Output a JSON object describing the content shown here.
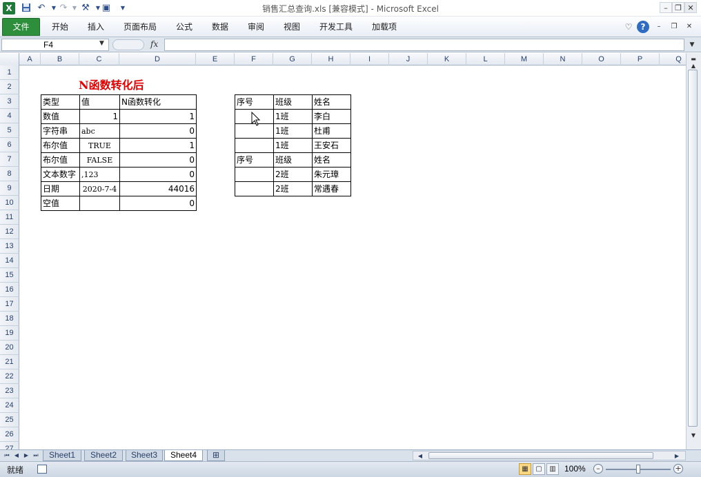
{
  "window": {
    "title": "销售汇总查询.xls  [兼容模式] - Microsoft Excel",
    "app_icon": "excel-logo",
    "brand_color": "#1f7a3a"
  },
  "quick_access": {
    "icons": [
      "save-icon",
      "undo-icon",
      "redo-icon",
      "tools-icon",
      "camera-icon",
      "customize-icon"
    ]
  },
  "ribbon": {
    "tabs": [
      "文件",
      "开始",
      "插入",
      "页面布局",
      "公式",
      "数据",
      "审阅",
      "视图",
      "开发工具",
      "加载项"
    ],
    "active_tab": "文件",
    "active_tab_color": "#2d8f3c"
  },
  "formula_bar": {
    "name_box": "F4",
    "fx_label": "fx",
    "formula": ""
  },
  "grid": {
    "columns": [
      "A",
      "B",
      "C",
      "D",
      "E",
      "F",
      "G",
      "H",
      "I",
      "J",
      "K",
      "L",
      "M",
      "N",
      "O",
      "P",
      "Q"
    ],
    "rows": [
      "1",
      "2",
      "3",
      "4",
      "5",
      "6",
      "7",
      "8",
      "9",
      "10",
      "11",
      "12",
      "13",
      "14",
      "15",
      "16",
      "17",
      "18",
      "19",
      "20",
      "21",
      "22",
      "23",
      "24",
      "25",
      "26",
      "27"
    ],
    "selected_cell": "F4"
  },
  "sheet": {
    "title": "N函数转化后",
    "title_color": "#e00000",
    "table1": {
      "headers": [
        "类型",
        "值",
        "N函数转化"
      ],
      "rows": [
        [
          "数值",
          "1",
          "1"
        ],
        [
          "字符串",
          "abc",
          "0"
        ],
        [
          "布尔值",
          "TRUE",
          "1"
        ],
        [
          "布尔值",
          "FALSE",
          "0"
        ],
        [
          "文本数字",
          ",123",
          "0"
        ],
        [
          "日期",
          "2020-7-4",
          "44016"
        ],
        [
          "空值",
          "",
          "0"
        ]
      ]
    },
    "table2": {
      "rows": [
        [
          "序号",
          "班级",
          "姓名"
        ],
        [
          "",
          "1班",
          "李白"
        ],
        [
          "",
          "1班",
          "杜甫"
        ],
        [
          "",
          "1班",
          "王安石"
        ],
        [
          "序号",
          "班级",
          "姓名"
        ],
        [
          "",
          "2班",
          "朱元璋"
        ],
        [
          "",
          "2班",
          "常遇春"
        ]
      ]
    }
  },
  "sheet_tabs": {
    "tabs": [
      "Sheet1",
      "Sheet2",
      "Sheet3",
      "Sheet4"
    ],
    "active": "Sheet4"
  },
  "status_bar": {
    "ready": "就绪",
    "zoom": "100%",
    "zoom_fraction": 1.0
  }
}
